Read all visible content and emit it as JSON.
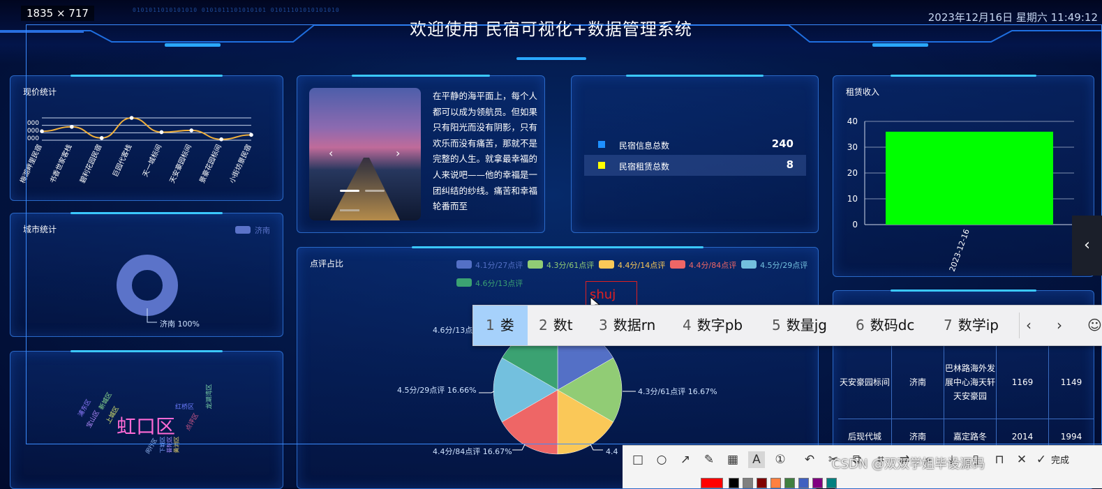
{
  "screen": {
    "size_badge": "1835 × 717"
  },
  "header": {
    "title": "欢迎使用 民宿可视化+数据管理系统",
    "datetime": "2023年12月16日 星期六 11:49:12",
    "binary_deco": "0101011010101010 0101011101010101 01011101010101010"
  },
  "price_panel": {
    "title": "现价统计",
    "yticks": [
      "000",
      "000",
      "000"
    ],
    "categories": [
      "梅湖畔里民宿",
      "书香世家客栈",
      "碧利花园民宿",
      "巨园代客栈",
      "天一城标间",
      "天安豪园标间",
      "景豪花园标间",
      "小街坊景民宿"
    ]
  },
  "carousel": {
    "prev": "‹",
    "next": "›"
  },
  "prose": {
    "text": "在平静的海平面上，每个人都可以成为领航员。但如果只有阳光而没有阴影，只有欢乐而没有痛苦，那就不是完整的人生。就拿最幸福的人来说吧——他的幸福是一团纠结的纱线。痛苦和幸福轮番而至"
  },
  "stats": {
    "rows": [
      {
        "label": "民宿信息总数",
        "value": "240",
        "color": "#1e90ff"
      },
      {
        "label": "民宿租赁总数",
        "value": "8",
        "color": "#ffff00"
      }
    ]
  },
  "rent_panel": {
    "title": "租赁收入"
  },
  "city_panel": {
    "title": "城市统计",
    "legend": "济南",
    "slice_label": "济南 100%"
  },
  "pie_panel": {
    "title": "点评占比"
  },
  "wordcloud": {
    "words": [
      {
        "text": "虹口区",
        "color": "#ff6ad5"
      },
      {
        "text": "红桥区",
        "color": "#6c7cff"
      },
      {
        "text": "点评区",
        "color": "#d65a8a"
      },
      {
        "text": "宝山区",
        "color": "#b48cff"
      },
      {
        "text": "浦东区",
        "color": "#8f7bff"
      },
      {
        "text": "新城区",
        "color": "#8fe08f"
      },
      {
        "text": "上城区",
        "color": "#d7e46f"
      },
      {
        "text": "龙湖湾区",
        "color": "#7bd3a8"
      },
      {
        "text": "闵行区",
        "color": "#9dc3ff"
      },
      {
        "text": "下城区",
        "color": "#7aa0ff"
      },
      {
        "text": "普陀区",
        "color": "#a98cff"
      },
      {
        "text": "黄浦区",
        "color": "#e8d46c"
      }
    ]
  },
  "table": {
    "rows": [
      [
        "天安豪园标间",
        "济南",
        "巴林路海外发展中心海天轩天安豪园",
        "1169",
        "1149"
      ],
      [
        "后现代城",
        "济南",
        "嘉定路冬",
        "2014",
        "1994"
      ]
    ]
  },
  "ime": {
    "candidates": [
      {
        "num": "1",
        "text": "娄"
      },
      {
        "num": "2",
        "text": "数t"
      },
      {
        "num": "3",
        "text": "数据rn"
      },
      {
        "num": "4",
        "text": "数字pb"
      },
      {
        "num": "5",
        "text": "数量jg"
      },
      {
        "num": "6",
        "text": "数码dc"
      },
      {
        "num": "7",
        "text": "数学ip"
      }
    ],
    "prev": "‹",
    "next": "›",
    "emoji": "☺"
  },
  "annotation": {
    "text": "shuj"
  },
  "capture_toolbar": {
    "done_label": "完成",
    "watermark": "CSDN @双双学姐毕设源码",
    "swatches": [
      "#ff0000",
      "#000000",
      "#808080",
      "#800000",
      "#ff8040",
      "#408040",
      "#4060c0",
      "#800080",
      "#008080"
    ]
  },
  "sidehandle": {
    "glyph": "‹"
  },
  "chart_data": [
    {
      "type": "line",
      "title": "现价统计",
      "categories": [
        "梅湖畔里民宿",
        "书香世家客栈",
        "碧利花园民宿",
        "巨园代客栈",
        "天一城标间",
        "天安豪园标间",
        "景豪花园标间",
        "小街坊景民宿"
      ],
      "values": [
        2,
        3,
        0.5,
        5,
        1.8,
        2.2,
        0.2,
        1.2
      ],
      "line_color": "#f0b03c"
    },
    {
      "type": "bar",
      "title": "租赁收入",
      "categories": [
        "2023-12-16"
      ],
      "values": [
        36
      ],
      "ylim": [
        0,
        40
      ],
      "yticks": [
        0,
        10,
        20,
        30,
        40
      ],
      "bar_color": "#00ff00"
    },
    {
      "type": "pie",
      "title": "城市统计",
      "labels": [
        "济南"
      ],
      "values": [
        100
      ],
      "colors": [
        "#5b73c9"
      ]
    },
    {
      "type": "pie",
      "title": "点评占比",
      "labels": [
        "4.1分/27点评",
        "4.3分/61点评",
        "4.4分/14点评",
        "4.4分/84点评",
        "4.5分/29点评",
        "4.6分/13点评"
      ],
      "values": [
        16.67,
        16.67,
        16.67,
        16.67,
        16.66,
        16.66
      ],
      "colors": [
        "#5470c6",
        "#91cc75",
        "#fac858",
        "#ee6666",
        "#73c0de",
        "#3ba272"
      ],
      "visible_slice_labels": [
        "4.6分/13点评",
        "4.5分/29点评 16.66%",
        "4.3分/61点评 16.67%",
        "4.4分/84点评 16.67%",
        "4.4"
      ]
    }
  ]
}
